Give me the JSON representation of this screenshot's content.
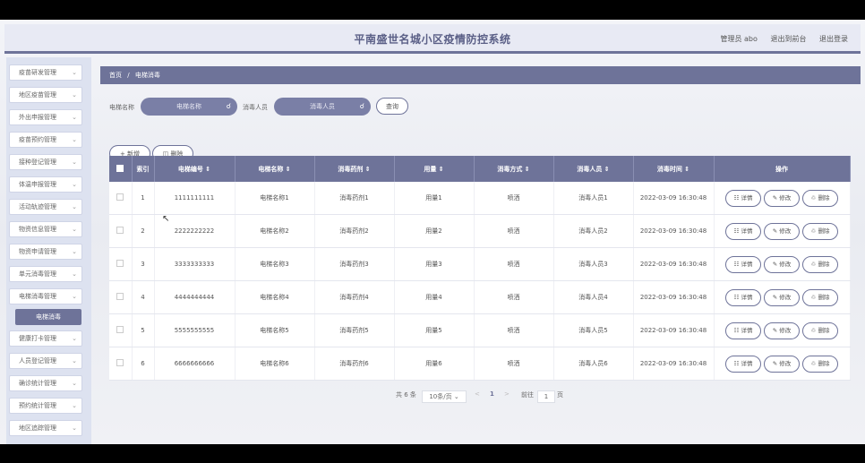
{
  "header": {
    "title": "平南盛世名城小区疫情防控系统",
    "admin": "管理员 abo",
    "back_admin": "退出到前台",
    "logout": "退出登录"
  },
  "sidebar": {
    "items": [
      {
        "label": "疫苗研发管理"
      },
      {
        "label": "地区疫苗管理"
      },
      {
        "label": "外出申报管理"
      },
      {
        "label": "疫苗预约管理"
      },
      {
        "label": "接种登记管理"
      },
      {
        "label": "体温申报管理"
      },
      {
        "label": "活动轨迹管理"
      },
      {
        "label": "物资信息管理"
      },
      {
        "label": "物资申请管理"
      },
      {
        "label": "单元消毒管理"
      },
      {
        "label": "电梯消毒管理"
      },
      {
        "label": "健康打卡管理"
      },
      {
        "label": "人员登记管理"
      },
      {
        "label": "确诊统计管理"
      },
      {
        "label": "预约统计管理"
      },
      {
        "label": "地区追踪管理"
      }
    ],
    "active_sub": "电梯消毒"
  },
  "breadcrumb": {
    "home": "首页",
    "sep": "/",
    "current": "电梯消毒"
  },
  "search": {
    "label1": "电梯名称",
    "placeholder1": "电梯名称",
    "label2": "消毒人员",
    "placeholder2": "消毒人员",
    "query": "查询"
  },
  "actions": {
    "add": "新增",
    "delete": "删除"
  },
  "table": {
    "headers": [
      "索引",
      "电梯编号 ⇕",
      "电梯名称 ⇕",
      "消毒药剂 ⇕",
      "用量 ⇕",
      "消毒方式 ⇕",
      "消毒人员 ⇕",
      "消毒时间 ⇕",
      "操作"
    ],
    "rows": [
      {
        "idx": "1",
        "no": "1111111111",
        "name": "电梯名称1",
        "agent": "消毒药剂1",
        "amount": "用量1",
        "method": "喷洒",
        "person": "消毒人员1",
        "time": "2022-03-09 16:30:48"
      },
      {
        "idx": "2",
        "no": "2222222222",
        "name": "电梯名称2",
        "agent": "消毒药剂2",
        "amount": "用量2",
        "method": "喷洒",
        "person": "消毒人员2",
        "time": "2022-03-09 16:30:48"
      },
      {
        "idx": "3",
        "no": "3333333333",
        "name": "电梯名称3",
        "agent": "消毒药剂3",
        "amount": "用量3",
        "method": "喷洒",
        "person": "消毒人员3",
        "time": "2022-03-09 16:30:48"
      },
      {
        "idx": "4",
        "no": "4444444444",
        "name": "电梯名称4",
        "agent": "消毒药剂4",
        "amount": "用量4",
        "method": "喷洒",
        "person": "消毒人员4",
        "time": "2022-03-09 16:30:48"
      },
      {
        "idx": "5",
        "no": "5555555555",
        "name": "电梯名称5",
        "agent": "消毒药剂5",
        "amount": "用量5",
        "method": "喷洒",
        "person": "消毒人员5",
        "time": "2022-03-09 16:30:48"
      },
      {
        "idx": "6",
        "no": "6666666666",
        "name": "电梯名称6",
        "agent": "消毒药剂6",
        "amount": "用量6",
        "method": "喷洒",
        "person": "消毒人员6",
        "time": "2022-03-09 16:30:48"
      }
    ],
    "row_actions": {
      "detail": "详情",
      "edit": "修改",
      "delete": "删除"
    }
  },
  "pager": {
    "total": "共 6 条",
    "page_size": "10条/页",
    "prev": "<",
    "page": "1",
    "next": ">",
    "goto_label": "前往",
    "goto_value": "1",
    "goto_suffix": "页"
  }
}
